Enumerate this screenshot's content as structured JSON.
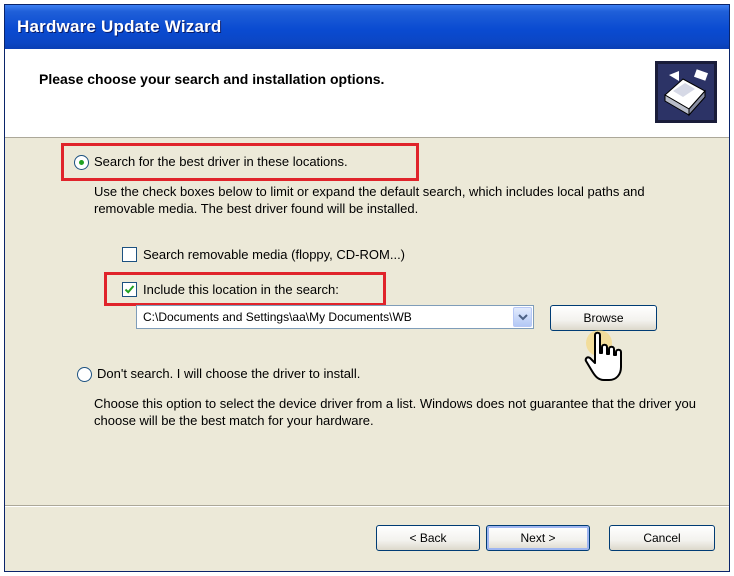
{
  "window": {
    "title": "Hardware Update Wizard"
  },
  "header": {
    "title": "Please choose your search and installation options.",
    "icon": "hardware-wizard-icon"
  },
  "options": {
    "search": {
      "label": "Search for the best driver in these locations.",
      "selected": true,
      "description": "Use the check boxes below to limit or expand the default search, which includes local paths and removable media. The best driver found will be installed.",
      "removable_media": {
        "label": "Search removable media (floppy, CD-ROM...)",
        "checked": false
      },
      "include_location": {
        "label": "Include this location in the search:",
        "checked": true
      },
      "location_value": "C:\\Documents and Settings\\aa\\My Documents\\WB",
      "browse_label": "Browse"
    },
    "dont_search": {
      "label": "Don't search. I will choose the driver to install.",
      "selected": false,
      "description": "Choose this option to select the device driver from a list. Windows does not guarantee that the driver you choose will be the best match for your hardware."
    }
  },
  "footer": {
    "back_label": "< Back",
    "next_label": "Next >",
    "cancel_label": "Cancel"
  },
  "colors": {
    "titlebar": "#0a4bd1",
    "highlight": "#e0242b",
    "dialog_bg": "#ece9d8"
  }
}
